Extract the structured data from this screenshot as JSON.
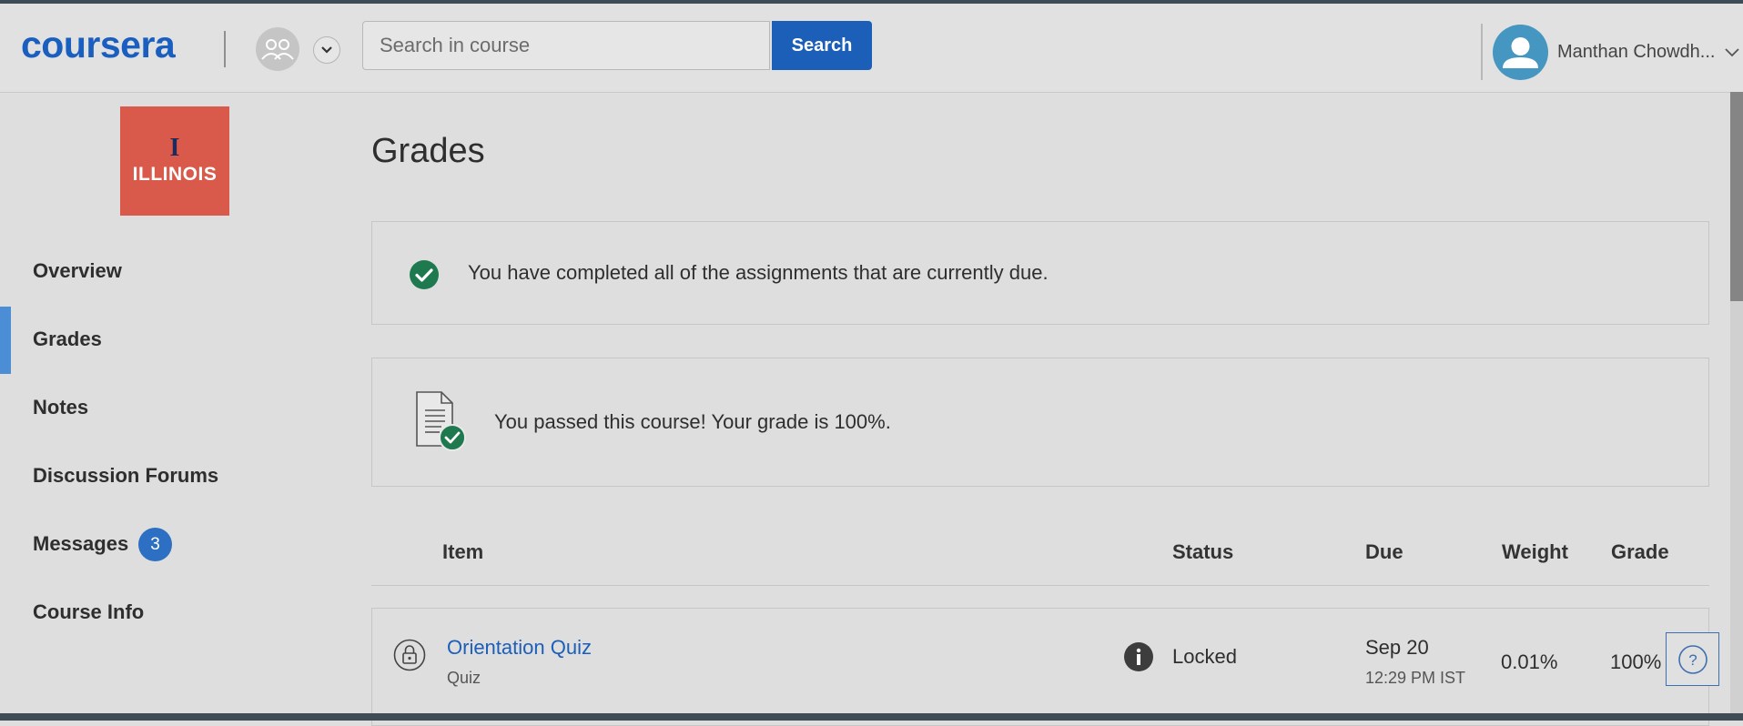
{
  "header": {
    "logo_text": "coursera",
    "search": {
      "placeholder": "Search in course",
      "value": "",
      "button_label": "Search"
    },
    "user": {
      "name": "Manthan Chowdh..."
    }
  },
  "sidebar": {
    "university_logo": {
      "mark": "I",
      "text": "ILLINOIS"
    },
    "items": [
      {
        "label": "Overview",
        "active": false
      },
      {
        "label": "Grades",
        "active": true
      },
      {
        "label": "Notes",
        "active": false
      },
      {
        "label": "Discussion Forums",
        "active": false
      },
      {
        "label": "Messages",
        "active": false,
        "badge": "3"
      },
      {
        "label": "Course Info",
        "active": false
      }
    ]
  },
  "main": {
    "title": "Grades",
    "completed_message": "You have completed all of the assignments that are currently due.",
    "passed_message": "You passed this course! Your grade is 100%.",
    "table": {
      "headers": {
        "item": "Item",
        "status": "Status",
        "due": "Due",
        "weight": "Weight",
        "grade": "Grade"
      },
      "rows": [
        {
          "name": "Orientation Quiz",
          "type": "Quiz",
          "status": "Locked",
          "due_date": "Sep 20",
          "due_time": "12:29 PM IST",
          "weight": "0.01%",
          "grade": "100%"
        }
      ]
    }
  },
  "colors": {
    "brand_blue": "#1c5fb9",
    "success_green": "#1e7a4e",
    "illinois_orange": "#d9594a",
    "active_nav": "#4b8ed6"
  },
  "icons": {
    "success": "check-circle-icon",
    "certificate": "document-check-icon",
    "lock": "lock-icon",
    "info": "info-icon",
    "help": "question-icon"
  }
}
